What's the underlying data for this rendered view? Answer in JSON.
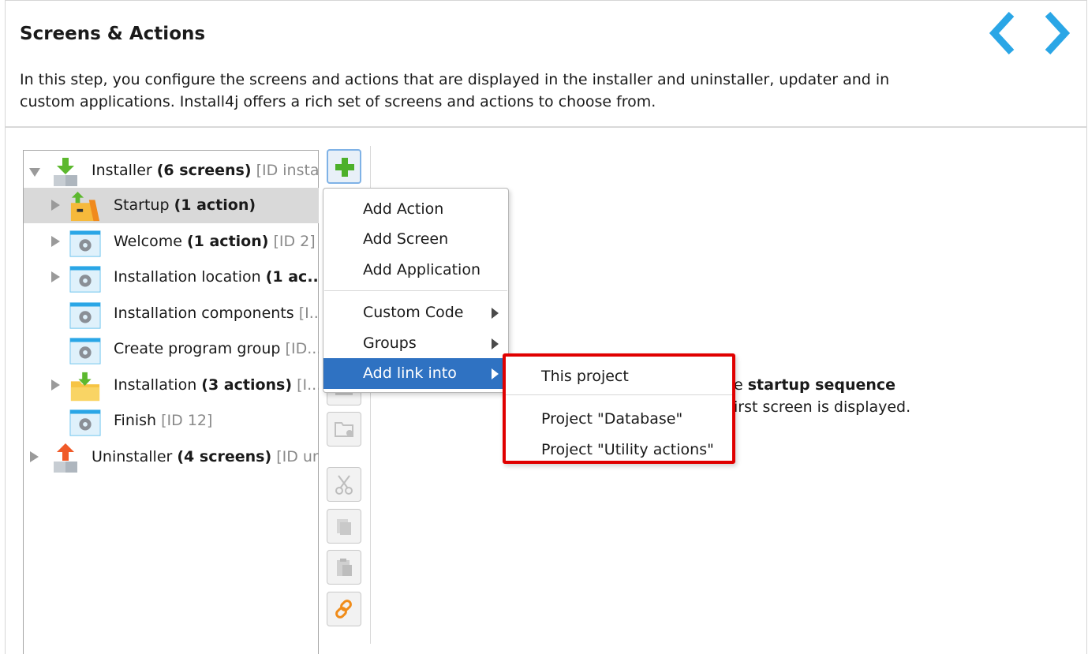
{
  "header": {
    "title": "Screens & Actions",
    "description": "In this step, you configure the screens and actions that are displayed in the installer and uninstaller, updater and in custom applications. Install4j offers a rich set of screens and actions to choose from.",
    "nav_back_icon": "chevron-left-icon",
    "nav_forward_icon": "chevron-right-icon",
    "accent_color": "#2aa6e6"
  },
  "tree": {
    "items": [
      {
        "name": "Installer",
        "bold": "(6 screens)",
        "gray": "[ID instal...",
        "expanded": true,
        "icon": "installer-download-icon"
      },
      {
        "name": "Startup",
        "bold": "(1 action)",
        "gray": "",
        "selected": true,
        "icon": "startup-folder-icon"
      },
      {
        "name": "Welcome",
        "bold": "(1 action)",
        "gray": "[ID 2]",
        "icon": "screen-gear-icon"
      },
      {
        "name": "Installation location",
        "bold": "(1 ac...",
        "gray": "",
        "icon": "screen-gear-icon"
      },
      {
        "name": "Installation components",
        "bold": "",
        "gray": "[I...",
        "icon": "screen-gear-icon"
      },
      {
        "name": "Create program group",
        "bold": "",
        "gray": "[ID...",
        "icon": "screen-gear-icon"
      },
      {
        "name": "Installation",
        "bold": "(3 actions)",
        "gray": "[I...",
        "icon": "installation-folder-icon"
      },
      {
        "name": "Finish",
        "bold": "",
        "gray": "[ID 12]",
        "icon": "screen-gear-icon"
      },
      {
        "name": "Uninstaller",
        "bold": "(4 screens)",
        "gray": "[ID un...",
        "icon": "uninstaller-upload-icon"
      }
    ]
  },
  "toolbar": {
    "add_icon": "plus-icon",
    "buttons": [
      "plus-icon",
      "screen-icon",
      "folder-icon",
      "cut-icon",
      "copy-icon",
      "paste-icon",
      "link-icon"
    ]
  },
  "info": {
    "line1_prefix": "e",
    "line1_bold": "startup sequence",
    "line2": "irst screen is displayed."
  },
  "context_menu": {
    "add_action": "Add Action",
    "add_screen": "Add Screen",
    "add_application": "Add Application",
    "custom_code": "Custom Code",
    "groups": "Groups",
    "add_link_into": "Add link into"
  },
  "link_submenu": {
    "this_project": "This project",
    "project_database": "Project \"Database\"",
    "project_utility": "Project \"Utility actions\""
  }
}
